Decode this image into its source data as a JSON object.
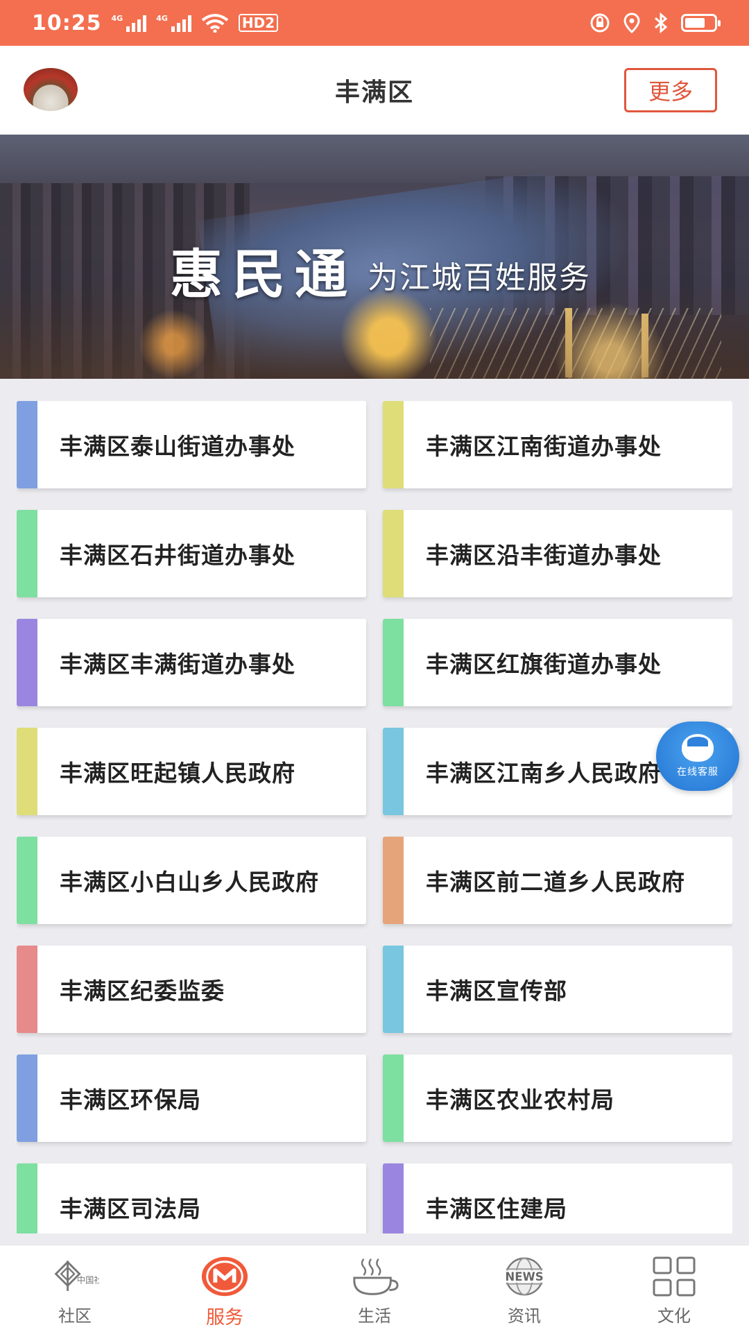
{
  "status_bar": {
    "time": "10:25",
    "network_1": "4G",
    "network_2": "4G",
    "hd_label": "HD2",
    "battery_level": 0.7
  },
  "header": {
    "title": "丰满区",
    "more_label": "更多"
  },
  "banner": {
    "title": "惠民通",
    "subtitle": "为江城百姓服务"
  },
  "grid": {
    "items": [
      {
        "label": "丰满区泰山街道办事处",
        "accent": "#7f9fe0"
      },
      {
        "label": "丰满区江南街道办事处",
        "accent": "#dedd78"
      },
      {
        "label": "丰满区石井街道办事处",
        "accent": "#7ddfa0"
      },
      {
        "label": "丰满区沿丰街道办事处",
        "accent": "#dedd78"
      },
      {
        "label": "丰满区丰满街道办事处",
        "accent": "#9a86e0"
      },
      {
        "label": "丰满区红旗街道办事处",
        "accent": "#7ddfa0"
      },
      {
        "label": "丰满区旺起镇人民政府",
        "accent": "#dedd78"
      },
      {
        "label": "丰满区江南乡人民政府",
        "accent": "#78c6e0"
      },
      {
        "label": "丰满区小白山乡人民政府",
        "accent": "#7ddfa0"
      },
      {
        "label": "丰满区前二道乡人民政府",
        "accent": "#e6a47a"
      },
      {
        "label": "丰满区纪委监委",
        "accent": "#e68a8a"
      },
      {
        "label": "丰满区宣传部",
        "accent": "#78c6e0"
      },
      {
        "label": "丰满区环保局",
        "accent": "#7f9fe0"
      },
      {
        "label": "丰满区农业农村局",
        "accent": "#7ddfa0"
      },
      {
        "label": "丰满区司法局",
        "accent": "#7ddfa0"
      },
      {
        "label": "丰满区住建局",
        "accent": "#9a86e0"
      }
    ]
  },
  "service_button": {
    "label": "在线客服"
  },
  "bottom_nav": {
    "items": [
      {
        "label": "社区",
        "icon": "community-logo-icon",
        "logo_text": "中国社区"
      },
      {
        "label": "服务",
        "icon": "service-icon",
        "active": true
      },
      {
        "label": "生活",
        "icon": "coffee-cup-icon"
      },
      {
        "label": "资讯",
        "icon": "news-globe-icon",
        "badge_text": "NEWS"
      },
      {
        "label": "文化",
        "icon": "grid-icon"
      }
    ]
  },
  "colors": {
    "brand": "#f36f4f",
    "accent_active": "#f05a3a",
    "fab": "#2f82db"
  }
}
